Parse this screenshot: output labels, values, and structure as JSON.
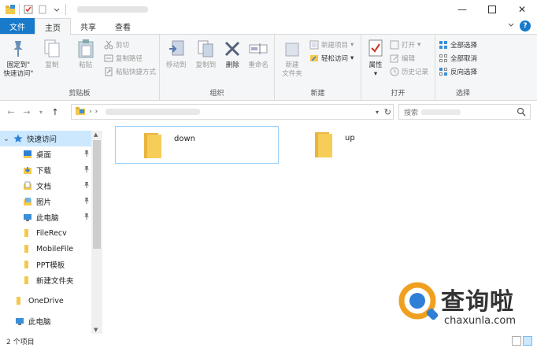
{
  "tabs": [
    {
      "label": "文件"
    },
    {
      "label": "主页"
    },
    {
      "label": "共享"
    },
    {
      "label": "查看"
    }
  ],
  "ribbon": {
    "clipboard": {
      "label": "剪贴板",
      "pin": "固定到\"\n快速访问\"",
      "copy": "复制",
      "paste": "粘贴",
      "cut": "剪切",
      "copy_path": "复制路径",
      "paste_shortcut": "粘贴快捷方式"
    },
    "organize": {
      "label": "组织",
      "move_to": "移动到",
      "copy_to": "复制到",
      "delete": "删除",
      "rename": "重命名"
    },
    "new": {
      "label": "新建",
      "new_folder": "新建\n文件夹",
      "new_item": "新建项目",
      "easy_access": "轻松访问"
    },
    "open": {
      "label": "打开",
      "properties": "属性",
      "open": "打开",
      "edit": "编辑",
      "history": "历史记录"
    },
    "select": {
      "label": "选择",
      "select_all": "全部选择",
      "select_none": "全部取消",
      "invert": "反向选择"
    }
  },
  "search": {
    "placeholder": "搜索"
  },
  "nav": {
    "quick_access": "快速访问",
    "items": [
      {
        "label": "桌面",
        "pinned": true
      },
      {
        "label": "下载",
        "pinned": true
      },
      {
        "label": "文档",
        "pinned": true
      },
      {
        "label": "图片",
        "pinned": true
      },
      {
        "label": "此电脑",
        "pinned": true
      },
      {
        "label": "FileRecv"
      },
      {
        "label": "MobileFile"
      },
      {
        "label": "PPT模板"
      },
      {
        "label": "新建文件夹"
      }
    ],
    "onedrive": "OneDrive",
    "this_pc": "此电脑"
  },
  "files": [
    {
      "name": "down",
      "selected": true
    },
    {
      "name": "up",
      "selected": false
    }
  ],
  "status": {
    "count": "2 个项目"
  },
  "watermark": {
    "name": "查询啦",
    "domain": "chaxunla.com"
  },
  "colors": {
    "accent": "#1979ca",
    "selection": "#cce8ff",
    "folder": "#f4c94b"
  }
}
